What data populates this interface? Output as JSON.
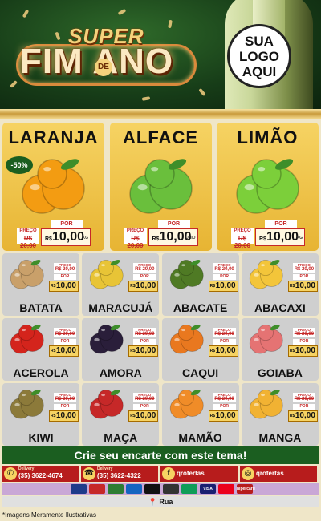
{
  "header": {
    "title_super": "SUPER",
    "title_main": "FIM ANO",
    "title_de": "DE",
    "logo_placeholder": [
      "SUA",
      "LOGO",
      "AQUI"
    ]
  },
  "featured": [
    {
      "name": "LARANJA",
      "badge": "-50%",
      "por": "POR",
      "preco_label": "PREÇO",
      "old_price": "R$ 20,00",
      "currency": "R$",
      "price": "10,00",
      "unit": "KG",
      "color": "#f39c12"
    },
    {
      "name": "ALFACE",
      "badge": "",
      "por": "POR",
      "preco_label": "PREÇO",
      "old_price": "R$ 20,00",
      "currency": "R$",
      "price": "10,00",
      "unit": "UNID",
      "color": "#6abf3c"
    },
    {
      "name": "LIMÃO",
      "badge": "",
      "por": "POR",
      "preco_label": "PREÇO",
      "old_price": "R$ 20,00",
      "currency": "R$",
      "price": "10,00",
      "unit": "KG",
      "color": "#7ccf3a"
    }
  ],
  "grid": [
    {
      "name": "BATATA",
      "preco_label": "PREÇO",
      "old_price": "R$ 20,00",
      "por": "POR",
      "currency": "R$",
      "price": "10,00",
      "unit": "KG",
      "color": "#c9a06a"
    },
    {
      "name": "MARACUJÁ",
      "preco_label": "PREÇO",
      "old_price": "R$ 20,00",
      "por": "POR",
      "currency": "R$",
      "price": "10,00",
      "unit": "KG",
      "color": "#e8c436"
    },
    {
      "name": "ABACATE",
      "preco_label": "PREÇO",
      "old_price": "R$ 20,00",
      "por": "POR",
      "currency": "R$",
      "price": "10,00",
      "unit": "KG",
      "color": "#4f7a24"
    },
    {
      "name": "ABACAXI",
      "preco_label": "PREÇO",
      "old_price": "R$ 20,00",
      "por": "POR",
      "currency": "R$",
      "price": "10,00",
      "unit": "KG",
      "color": "#f3c53a"
    },
    {
      "name": "ACEROLA",
      "preco_label": "PREÇO",
      "old_price": "R$ 20,00",
      "por": "POR",
      "currency": "R$",
      "price": "10,00",
      "unit": "KG",
      "color": "#d4241c"
    },
    {
      "name": "AMORA",
      "preco_label": "PREÇO",
      "old_price": "R$ 20,00",
      "por": "POR",
      "currency": "R$",
      "price": "10,00",
      "unit": "KG",
      "color": "#2a1e3a"
    },
    {
      "name": "CAQUI",
      "preco_label": "PREÇO",
      "old_price": "R$ 20,00",
      "por": "POR",
      "currency": "R$",
      "price": "10,00",
      "unit": "KG",
      "color": "#e9781f"
    },
    {
      "name": "GOIABA",
      "preco_label": "PREÇO",
      "old_price": "R$ 20,00",
      "por": "POR",
      "currency": "R$",
      "price": "10,00",
      "unit": "KG",
      "color": "#e57373"
    },
    {
      "name": "KIWI",
      "preco_label": "PREÇO",
      "old_price": "R$ 20,00",
      "por": "POR",
      "currency": "R$",
      "price": "10,00",
      "unit": "KG",
      "color": "#8c7a3a"
    },
    {
      "name": "MAÇA",
      "preco_label": "PREÇO",
      "old_price": "R$ 20,00",
      "por": "POR",
      "currency": "R$",
      "price": "10,00",
      "unit": "KG",
      "color": "#c62828"
    },
    {
      "name": "MAMÃO",
      "preco_label": "PREÇO",
      "old_price": "R$ 20,00",
      "por": "POR",
      "currency": "R$",
      "price": "10,00",
      "unit": "KG",
      "color": "#f08c28"
    },
    {
      "name": "MANGA",
      "preco_label": "PREÇO",
      "old_price": "R$ 20,00",
      "por": "POR",
      "currency": "R$",
      "price": "10,00",
      "unit": "KG",
      "color": "#f1b233"
    }
  ],
  "cta": "Crie seu encarte com este tema!",
  "contacts": [
    {
      "icon": "whatsapp-icon",
      "sub": "Delivery",
      "value": "(35) 3622-4674"
    },
    {
      "icon": "phone-icon",
      "sub": "Delivery",
      "value": "(35) 3622-4322"
    },
    {
      "icon": "facebook-icon",
      "sub": "",
      "value": "qrofertas"
    },
    {
      "icon": "instagram-icon",
      "sub": "",
      "value": "qrofertas"
    }
  ],
  "payments": [
    "",
    "",
    "",
    "",
    "",
    "",
    "",
    "VISA",
    "",
    "hipercard"
  ],
  "address": "Rua",
  "disclaimer": "*Imagens Meramente Ilustrativas"
}
